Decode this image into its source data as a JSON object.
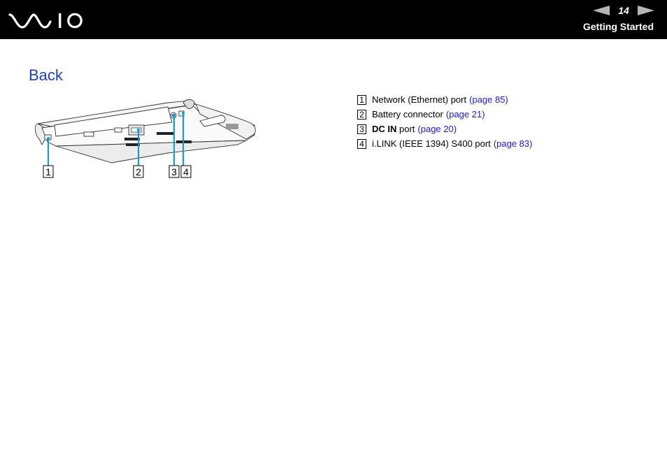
{
  "header": {
    "logo": "VAIO",
    "page_number": "14",
    "prev_icon": "prev-page-arrow",
    "next_icon": "next-page-arrow",
    "section": "Getting Started",
    "arrow_color": "#b5b5b5"
  },
  "title": "Back",
  "illustration": {
    "description": "Rear view of VAIO notebook with callouts",
    "callout_color": "#00a0dc",
    "callouts": [
      "1",
      "2",
      "3",
      "4"
    ]
  },
  "legend": [
    {
      "num": "1",
      "bold": "",
      "text": "Network (Ethernet) port",
      "link": "(page 85)"
    },
    {
      "num": "2",
      "bold": "",
      "text": "Battery connector",
      "link": "(page 21)"
    },
    {
      "num": "3",
      "bold": "DC IN",
      "text": " port",
      "link": "(page 20)"
    },
    {
      "num": "4",
      "bold": "",
      "text": "i.LINK (IEEE 1394) S400 port",
      "link": "(page 83)"
    }
  ]
}
